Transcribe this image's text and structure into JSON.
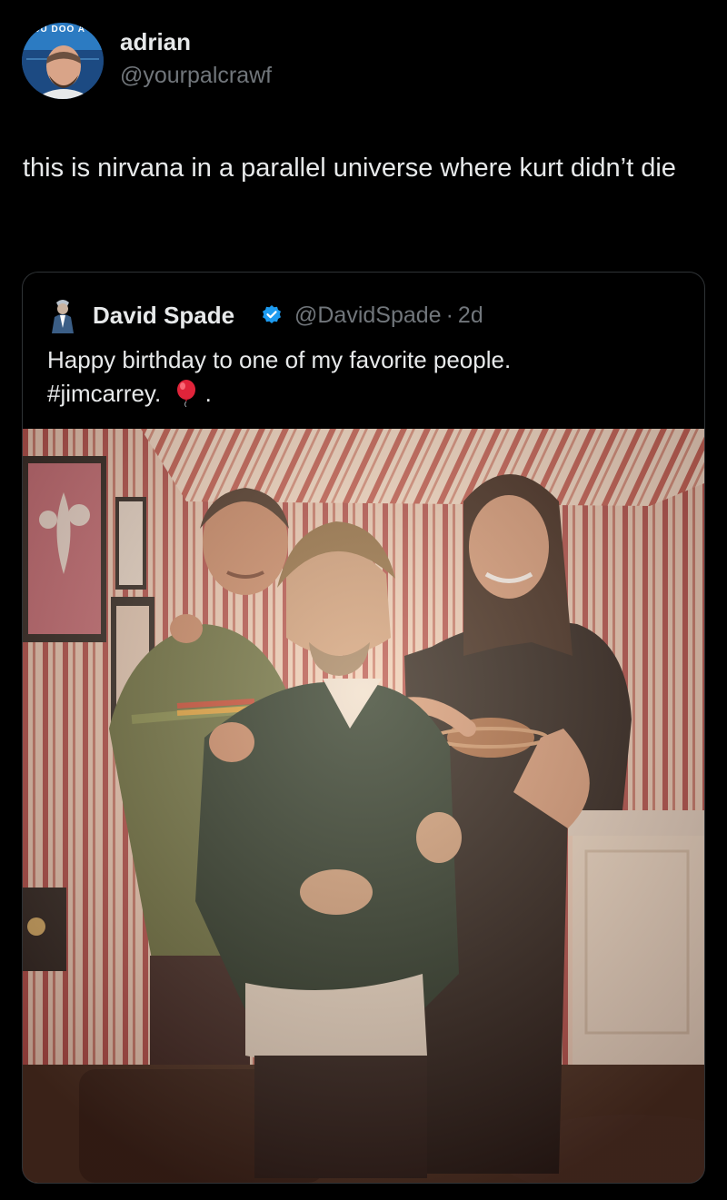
{
  "post": {
    "author": {
      "name": "adrian",
      "handle": "@yourpalcrawf",
      "avatar_badge_text": "JU DOO A"
    },
    "text": "this is nirvana in a parallel universe where kurt didn’t die",
    "quoted_post": {
      "author_name": "David Spade",
      "verified_icon": "verified-badge-icon",
      "handle": "@DavidSpade",
      "separator": "·",
      "age": "2d",
      "text_line1": "Happy birthday to one of my favorite people.",
      "hashtag": "#jimcarrey.",
      "trailing": ".",
      "emoji": "balloon-icon",
      "media": "photo of three men posing in a striped wallpapered room"
    }
  },
  "colors": {
    "background": "#000000",
    "text_primary": "#e7e9ea",
    "text_secondary": "#71767b",
    "border": "#2f3336",
    "verified_blue": "#1d9bf0",
    "balloon_red": "#e0243a"
  }
}
